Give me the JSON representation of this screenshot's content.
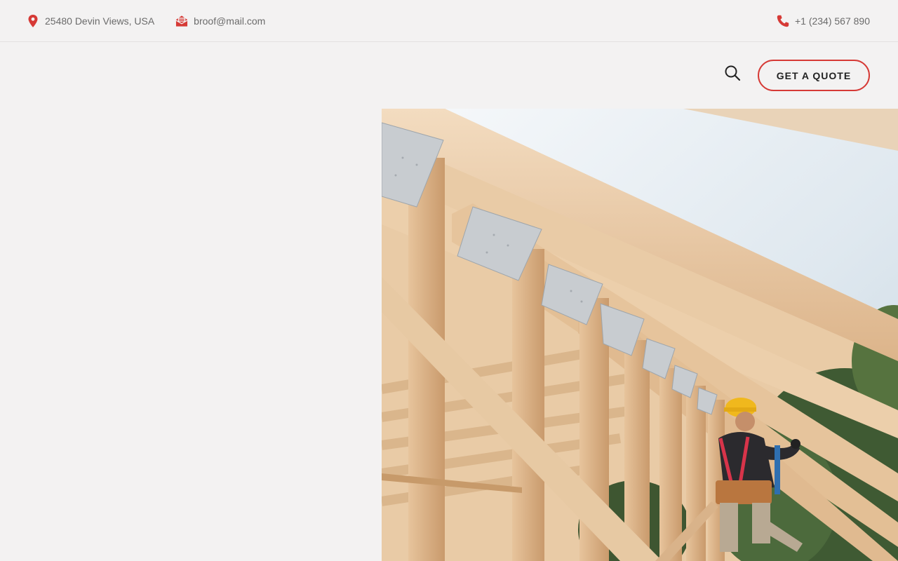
{
  "topbar": {
    "address": "25480 Devin Views, USA",
    "email": "broof@mail.com",
    "phone": "+1 (234) 567 890"
  },
  "header": {
    "cta_label": "GET A QUOTE"
  },
  "icons": {
    "address": "location-pin-icon",
    "email": "envelope-icon",
    "phone": "phone-icon",
    "search": "search-icon"
  },
  "colors": {
    "accent": "#d63a36",
    "background": "#f3f2f2",
    "text": "#6b6b6b"
  }
}
